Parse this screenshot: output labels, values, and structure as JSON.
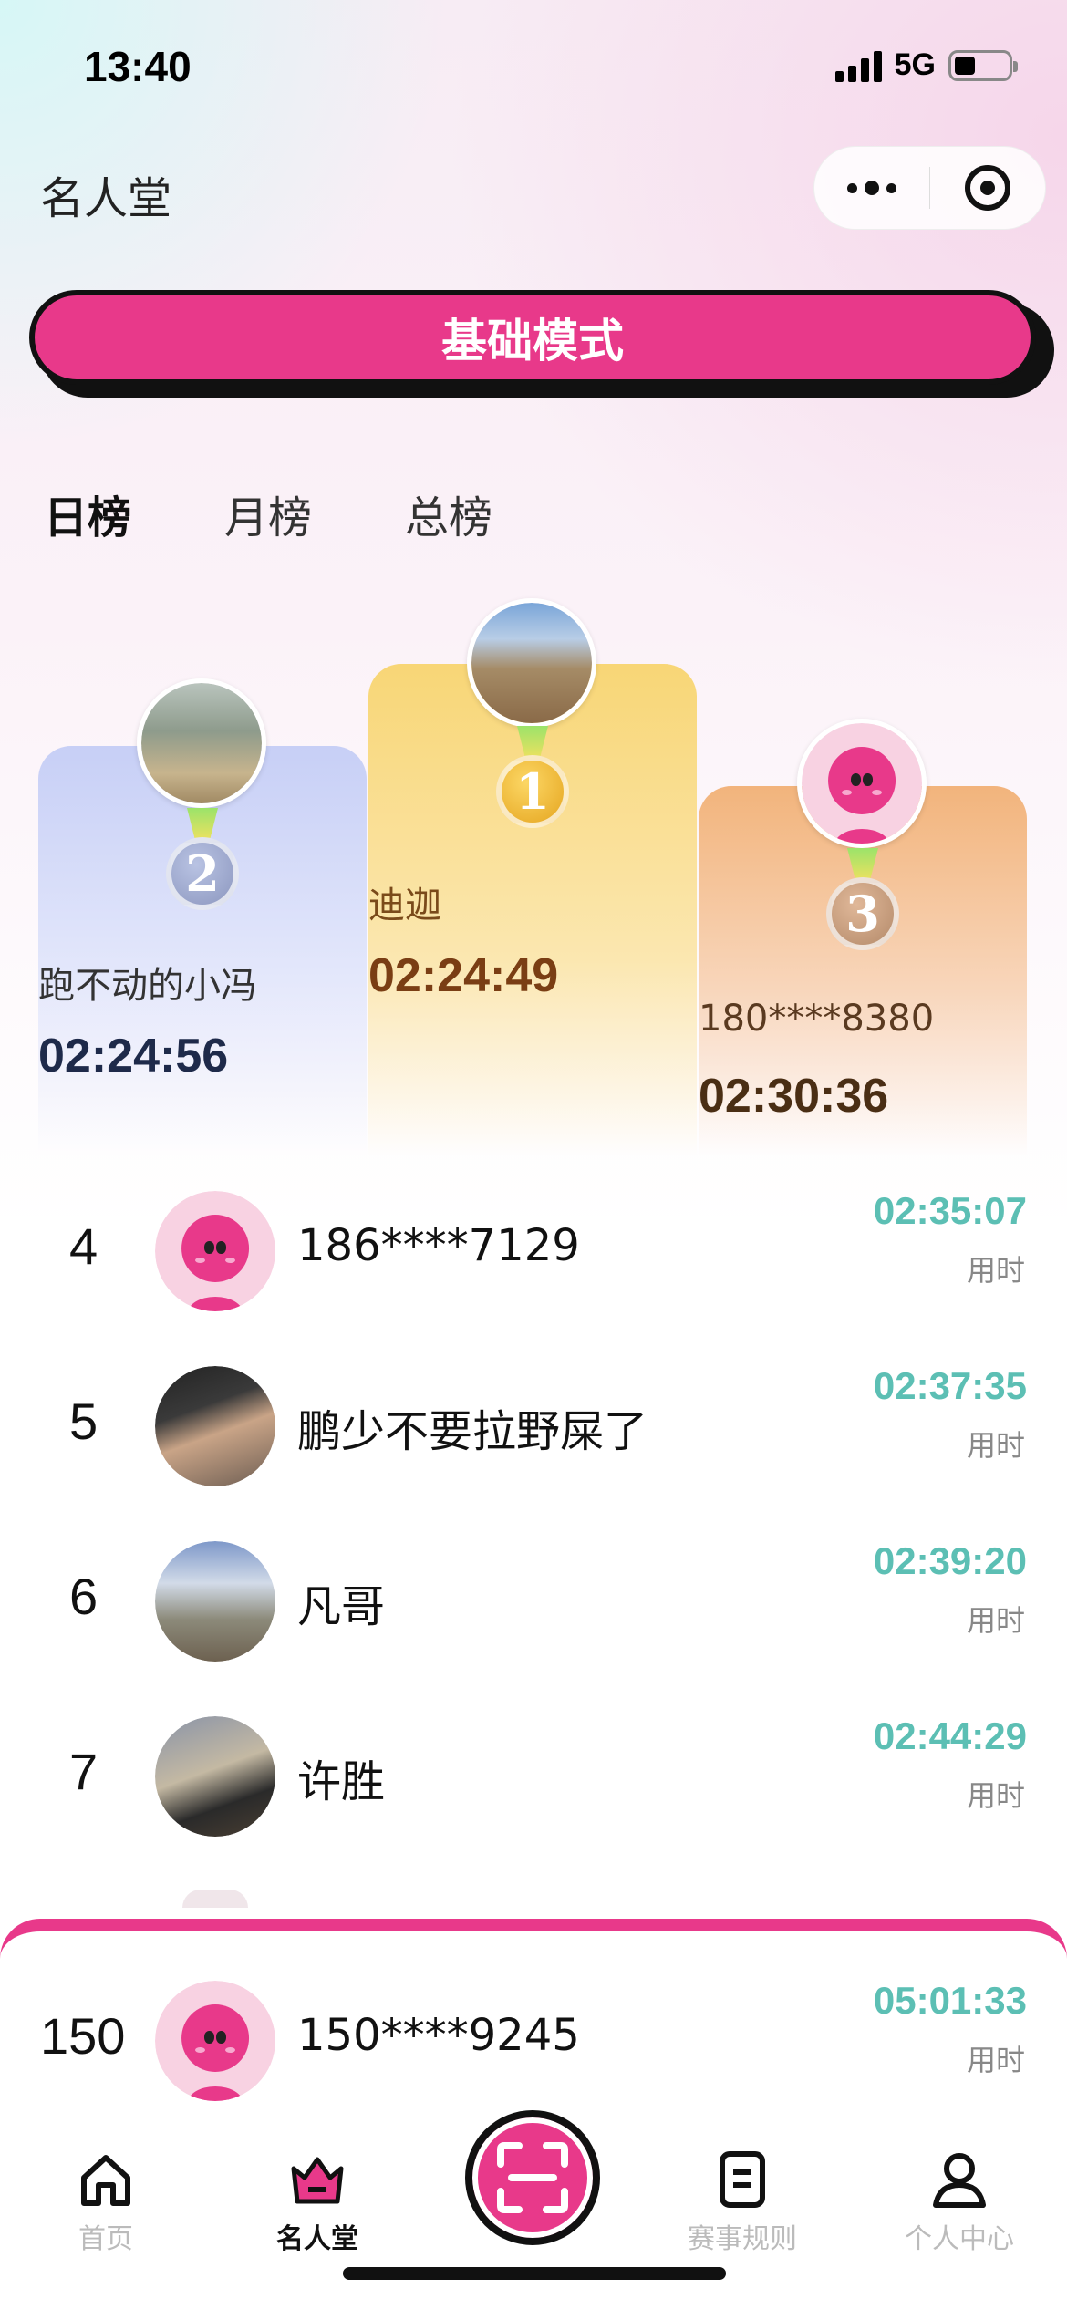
{
  "status_bar": {
    "time": "13:40",
    "network": "5G"
  },
  "header": {
    "title": "名人堂"
  },
  "mode_button": {
    "label": "基础模式"
  },
  "tabs": [
    {
      "label": "日榜",
      "active": true
    },
    {
      "label": "月榜",
      "active": false
    },
    {
      "label": "总榜",
      "active": false
    }
  ],
  "podium": {
    "first": {
      "rank": "1",
      "name": "迪迦",
      "time": "02:24:49"
    },
    "second": {
      "rank": "2",
      "name": "跑不动的小冯",
      "time": "02:24:56"
    },
    "third": {
      "rank": "3",
      "name": "180****8380",
      "time": "02:30:36"
    }
  },
  "ranking": [
    {
      "rank": "4",
      "name": "186****7129",
      "time": "02:35:07",
      "time_label": "用时",
      "avatar": "default"
    },
    {
      "rank": "5",
      "name": "鹏少不要拉野屎了",
      "time": "02:37:35",
      "time_label": "用时",
      "avatar": "photo"
    },
    {
      "rank": "6",
      "name": "凡哥",
      "time": "02:39:20",
      "time_label": "用时",
      "avatar": "photo"
    },
    {
      "rank": "7",
      "name": "许胜",
      "time": "02:44:29",
      "time_label": "用时",
      "avatar": "photo"
    }
  ],
  "my_rank": {
    "rank": "150",
    "name": "150****9245",
    "time": "05:01:33",
    "time_label": "用时"
  },
  "tabbar": [
    {
      "label": "首页",
      "icon": "home-icon",
      "active": false
    },
    {
      "label": "名人堂",
      "icon": "trophy-icon",
      "active": true
    },
    {
      "label": "",
      "icon": "scan-icon",
      "active": false
    },
    {
      "label": "赛事规则",
      "icon": "rules-icon",
      "active": false
    },
    {
      "label": "个人中心",
      "icon": "user-icon",
      "active": false
    }
  ],
  "colors": {
    "accent": "#e8398a",
    "time": "#5cbfb4",
    "gold": "#f8d676",
    "silver": "#c7cff6",
    "bronze": "#f2b47c"
  }
}
